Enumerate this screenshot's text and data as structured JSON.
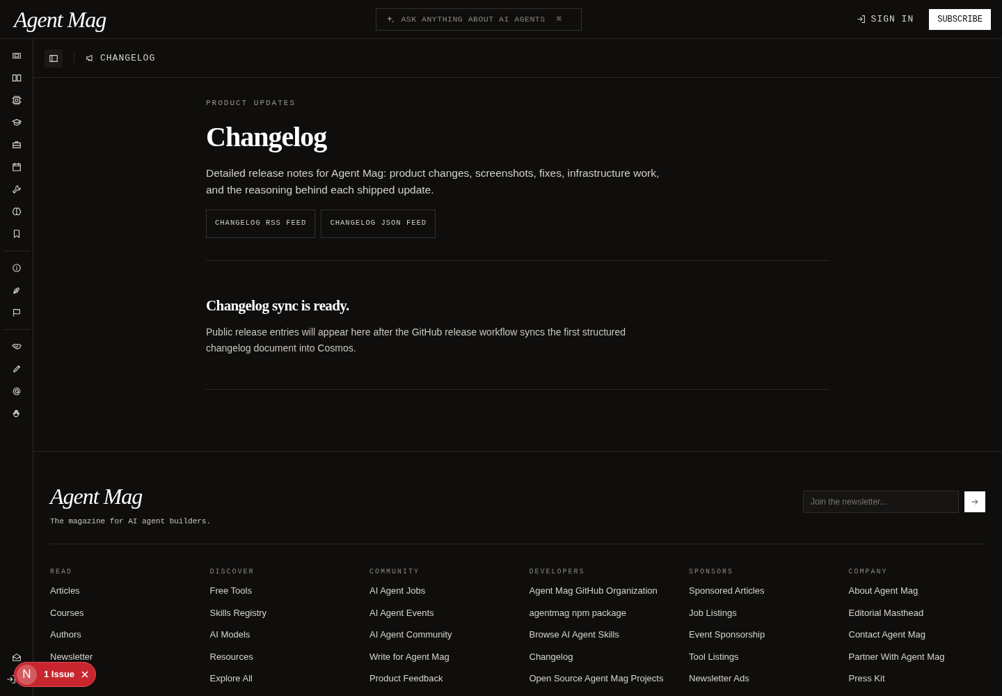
{
  "header": {
    "logo": "Agent Mag",
    "search": {
      "placeholder": "ASK ANYTHING ABOUT AI AGENTS",
      "shortcut": "⌘"
    },
    "sign_in": "SIGN IN",
    "subscribe": "SUBSCRIBE"
  },
  "breadcrumb": {
    "label": "CHANGELOG"
  },
  "hero": {
    "eyebrow": "PRODUCT UPDATES",
    "title": "Changelog",
    "description": "Detailed release notes for Agent Mag: product changes, screenshots, fixes, infrastructure work, and the reasoning behind each shipped update.",
    "buttons": [
      "CHANGELOG RSS FEED",
      "CHANGELOG JSON FEED"
    ]
  },
  "notice": {
    "title": "Changelog sync is ready.",
    "body": "Public release entries will appear here after the GitHub release workflow syncs the first structured changelog document into Cosmos."
  },
  "footer": {
    "logo": "Agent Mag",
    "tagline": "The magazine for AI agent builders.",
    "newsletter": {
      "placeholder": "Join the newsletter..."
    },
    "columns": [
      {
        "heading": "READ",
        "links": [
          "Articles",
          "Courses",
          "Authors",
          "Newsletter"
        ]
      },
      {
        "heading": "DISCOVER",
        "links": [
          "Free Tools",
          "Skills Registry",
          "AI Models",
          "Resources",
          "Explore All"
        ]
      },
      {
        "heading": "COMMUNITY",
        "links": [
          "AI Agent Jobs",
          "AI Agent Events",
          "AI Agent Community",
          "Write for Agent Mag",
          "Product Feedback"
        ]
      },
      {
        "heading": "DEVELOPERS",
        "links": [
          "Agent Mag GitHub Organization",
          "agentmag npm package",
          "Browse AI Agent Skills",
          "Changelog",
          "Open Source Agent Mag Projects"
        ]
      },
      {
        "heading": "SPONSORS",
        "links": [
          "Sponsored Articles",
          "Job Listings",
          "Event Sponsorship",
          "Tool Listings",
          "Newsletter Ads"
        ]
      },
      {
        "heading": "COMPANY",
        "links": [
          "About Agent Mag",
          "Editorial Masthead",
          "Contact Agent Mag",
          "Partner With Agent Mag",
          "Press Kit"
        ]
      }
    ]
  },
  "issue_badge": {
    "avatar": "N",
    "label": "1 Issue"
  }
}
